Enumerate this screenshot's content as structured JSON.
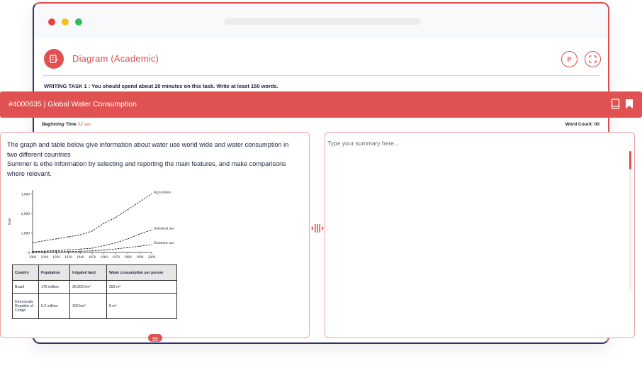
{
  "header": {
    "title": "Diagram (Academic)",
    "p_button": "P",
    "task_instruction": "WRITING TASK 1 : You should spend about 20 minutes on this task. Write at least 150 words."
  },
  "question": {
    "title": "#4000635 | Global Water Consumption",
    "beginning_label": "Beginning Time",
    "beginning_value": "02 sec",
    "word_count_label": "Word Count:",
    "word_count_value": "00"
  },
  "prompt": {
    "line1": "The graph and table below give information about water use world wide and water consumption in two different countries",
    "line2": "Summer is ethe information by selecting and reporting the main features, and make comparisons where relevant."
  },
  "chart_data": {
    "type": "line",
    "ylabel": "Km³",
    "x": [
      1900,
      1910,
      1920,
      1930,
      1940,
      1950,
      1960,
      1970,
      1980,
      1990,
      2000
    ],
    "xticks": [
      "1900",
      "1910",
      "1920",
      "1930",
      "1940",
      "1950",
      "1960",
      "1970",
      "1980",
      "1990",
      "2000"
    ],
    "yticks": [
      "0",
      "1,000",
      "2,000",
      "3,000"
    ],
    "ylim": [
      0,
      3200
    ],
    "series": [
      {
        "name": "Agriculture",
        "values": [
          500,
          600,
          700,
          800,
          900,
          1100,
          1500,
          1800,
          2200,
          2600,
          3000
        ]
      },
      {
        "name": "Industrial use",
        "values": [
          50,
          70,
          100,
          130,
          170,
          220,
          350,
          500,
          700,
          950,
          1150
        ]
      },
      {
        "name": "Domestic use",
        "values": [
          20,
          30,
          40,
          50,
          60,
          80,
          120,
          180,
          250,
          320,
          400
        ]
      }
    ]
  },
  "table": {
    "headers": [
      "Country",
      "Population",
      "Irrigated land",
      "Water consumption per person"
    ],
    "rows": [
      [
        "Brazil",
        "176 million",
        "26,500 km²",
        "359 m³"
      ],
      [
        "Democratic Republic of Congo",
        "5.2 million",
        "100 km²",
        "8 m³"
      ]
    ]
  },
  "answer": {
    "placeholder": "Type your summary here..."
  },
  "colors": {
    "accent": "#e05252",
    "navy": "#2c3468"
  }
}
